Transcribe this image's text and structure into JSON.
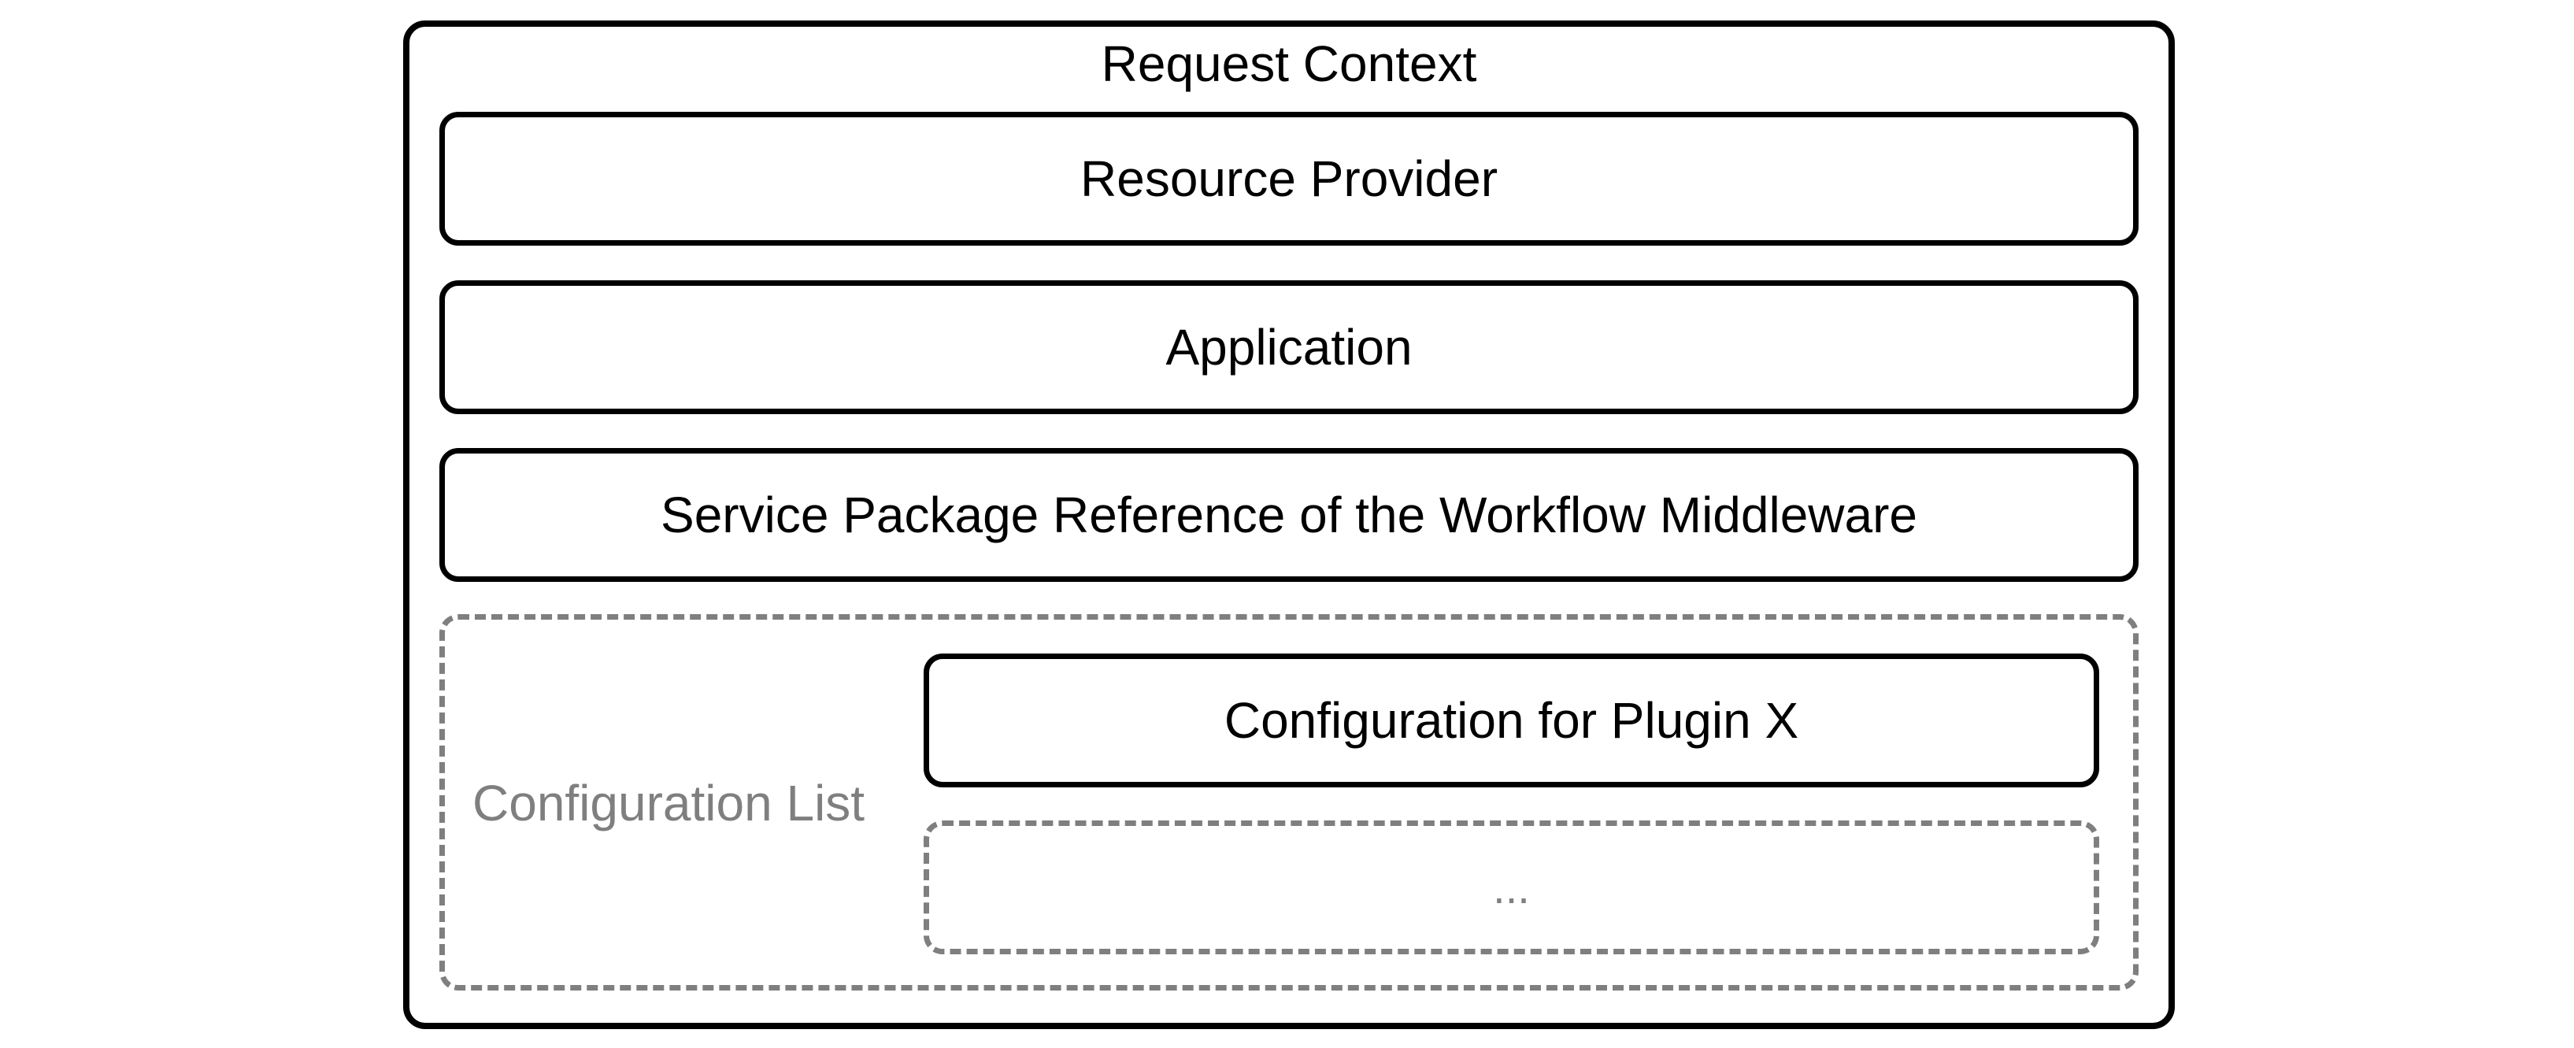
{
  "diagram": {
    "outer_title": "Request Context",
    "layers": [
      {
        "label": "Resource Provider"
      },
      {
        "label": "Application"
      },
      {
        "label": "Service Package Reference of the Workflow Middleware"
      }
    ],
    "configuration_list": {
      "label": "Configuration List",
      "items": [
        {
          "label": "Configuration for Plugin X"
        },
        {
          "label": "..."
        }
      ]
    }
  }
}
